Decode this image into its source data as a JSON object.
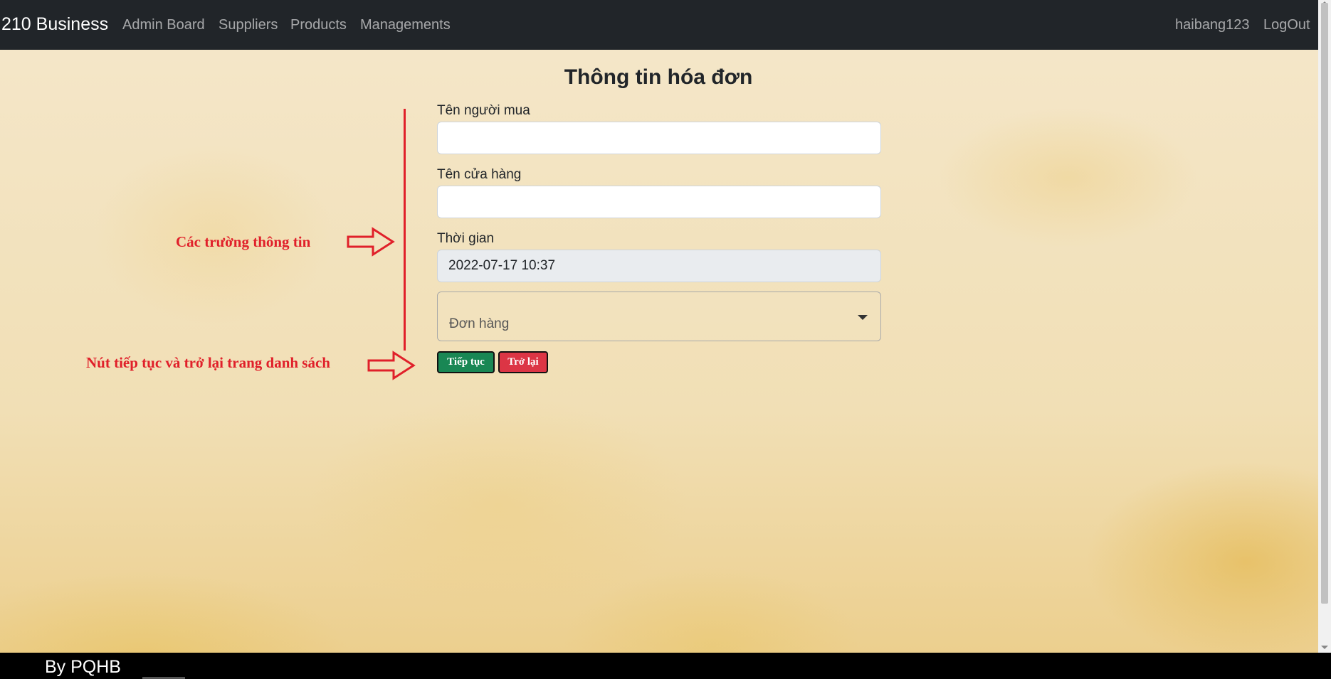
{
  "navbar": {
    "brand": "210 Business",
    "links": [
      "Admin Board",
      "Suppliers",
      "Products",
      "Managements"
    ],
    "user": "haibang123",
    "logout": "LogOut"
  },
  "form": {
    "title": "Thông tin hóa đơn",
    "buyer_label": "Tên người mua",
    "buyer_value": "",
    "store_label": "Tên cửa hàng",
    "store_value": "",
    "time_label": "Thời gian",
    "time_value": "2022-07-17 10:37",
    "order_select_label": "Đơn hàng",
    "continue_label": "Tiếp tục",
    "back_label": "Trở lại"
  },
  "annotations": {
    "fields_note": "Các trường thông tin",
    "buttons_note": "Nút tiếp tục và trở lại trang danh sách",
    "color": "#e0202a"
  },
  "footer": {
    "text": "By PQHB"
  }
}
